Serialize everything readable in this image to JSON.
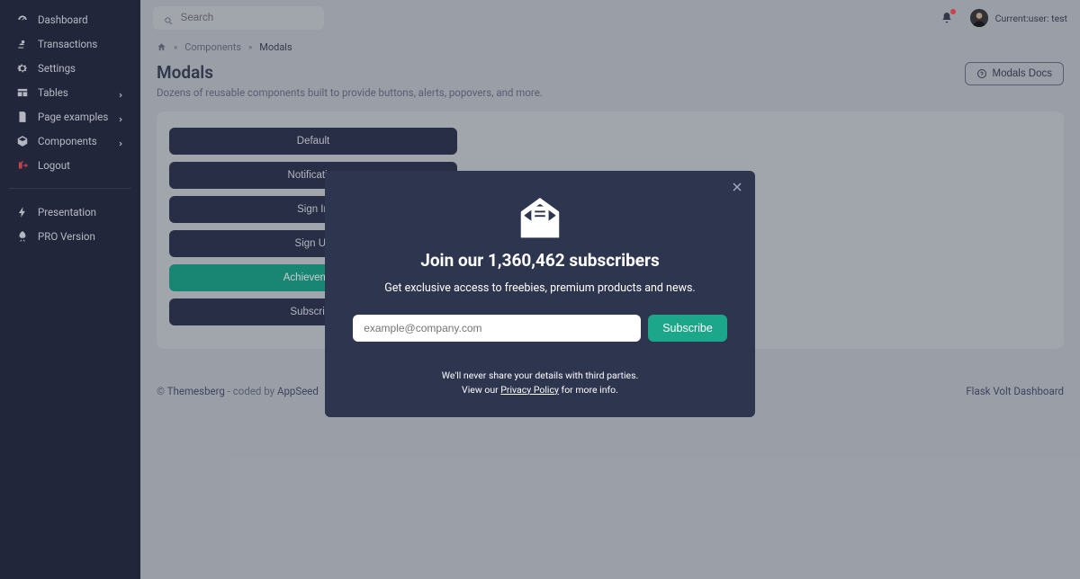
{
  "sidebar": {
    "items": [
      {
        "label": "Dashboard"
      },
      {
        "label": "Transactions"
      },
      {
        "label": "Settings"
      },
      {
        "label": "Tables"
      },
      {
        "label": "Page examples"
      },
      {
        "label": "Components"
      },
      {
        "label": "Logout"
      }
    ],
    "secondary": [
      {
        "label": "Presentation"
      },
      {
        "label": "PRO Version"
      }
    ]
  },
  "search": {
    "placeholder": "Search"
  },
  "user": {
    "label": "Current:user: test"
  },
  "breadcrumb": {
    "mid": "Components",
    "current": "Modals"
  },
  "page": {
    "title": "Modals",
    "subtitle": "Dozens of reusable components built to provide buttons, alerts, popovers, and more.",
    "docs_btn": "Modals Docs"
  },
  "triggers": {
    "b0": "Default",
    "b1": "Notification",
    "b2": "Sign In",
    "b3": "Sign Up",
    "b4": "Achievement",
    "b5": "Subscribe"
  },
  "footer": {
    "left_prefix": "© ",
    "left_brand": "Themesberg",
    "left_mid": " - coded by ",
    "left_author": "AppSeed",
    "right": "Flask Volt Dashboard"
  },
  "modal": {
    "title": "Join our 1,360,462 subscribers",
    "lead": "Get exclusive access to freebies, premium products and news.",
    "email_placeholder": "example@company.com",
    "subscribe": "Subscribe",
    "fine1": "We'll never share your details with third parties.",
    "fine2_pre": "View our ",
    "fine2_link": "Privacy Policy",
    "fine2_post": " for more info."
  }
}
